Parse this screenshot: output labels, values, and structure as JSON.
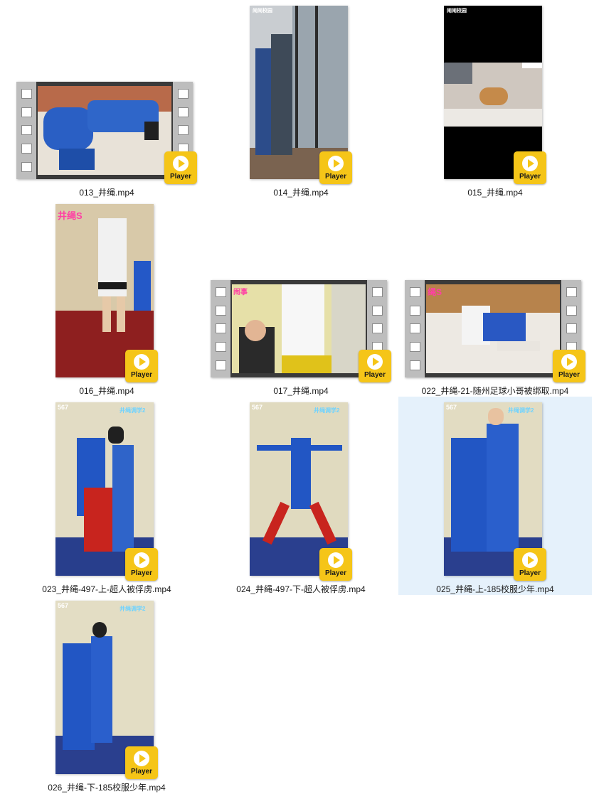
{
  "badge_label": "Player",
  "items": [
    {
      "name": "013_井绳.mp4"
    },
    {
      "name": "014_井绳.mp4",
      "overlay": "闹闹校园"
    },
    {
      "name": "015_井绳.mp4",
      "overlay": "闹闹校园"
    },
    {
      "name": "016_井绳.mp4",
      "overlay": "井绳S"
    },
    {
      "name": "017_井绳.mp4",
      "overlay": "闹事"
    },
    {
      "name": "022_井绳-21-随州足球小哥被绑取.mp4",
      "overlay": "绳S"
    },
    {
      "name": "023_井绳-497-上-超人被俘虏.mp4",
      "overlay": "567",
      "overlay2": "井绳调学2"
    },
    {
      "name": "024_井绳-497-下-超人被俘虏.mp4",
      "overlay": "567",
      "overlay2": "井绳调学2"
    },
    {
      "name": "025_井绳-上-185校服少年.mp4",
      "overlay": "567",
      "overlay2": "井绳调学2",
      "selected": true
    },
    {
      "name": "026_井绳-下-185校服少年.mp4",
      "overlay": "567",
      "overlay2": "井绳调学2"
    }
  ],
  "colors": {
    "badge": "#f5c518",
    "selection": "#e5f1fb",
    "uniform_blue": "#1f4fb3"
  }
}
